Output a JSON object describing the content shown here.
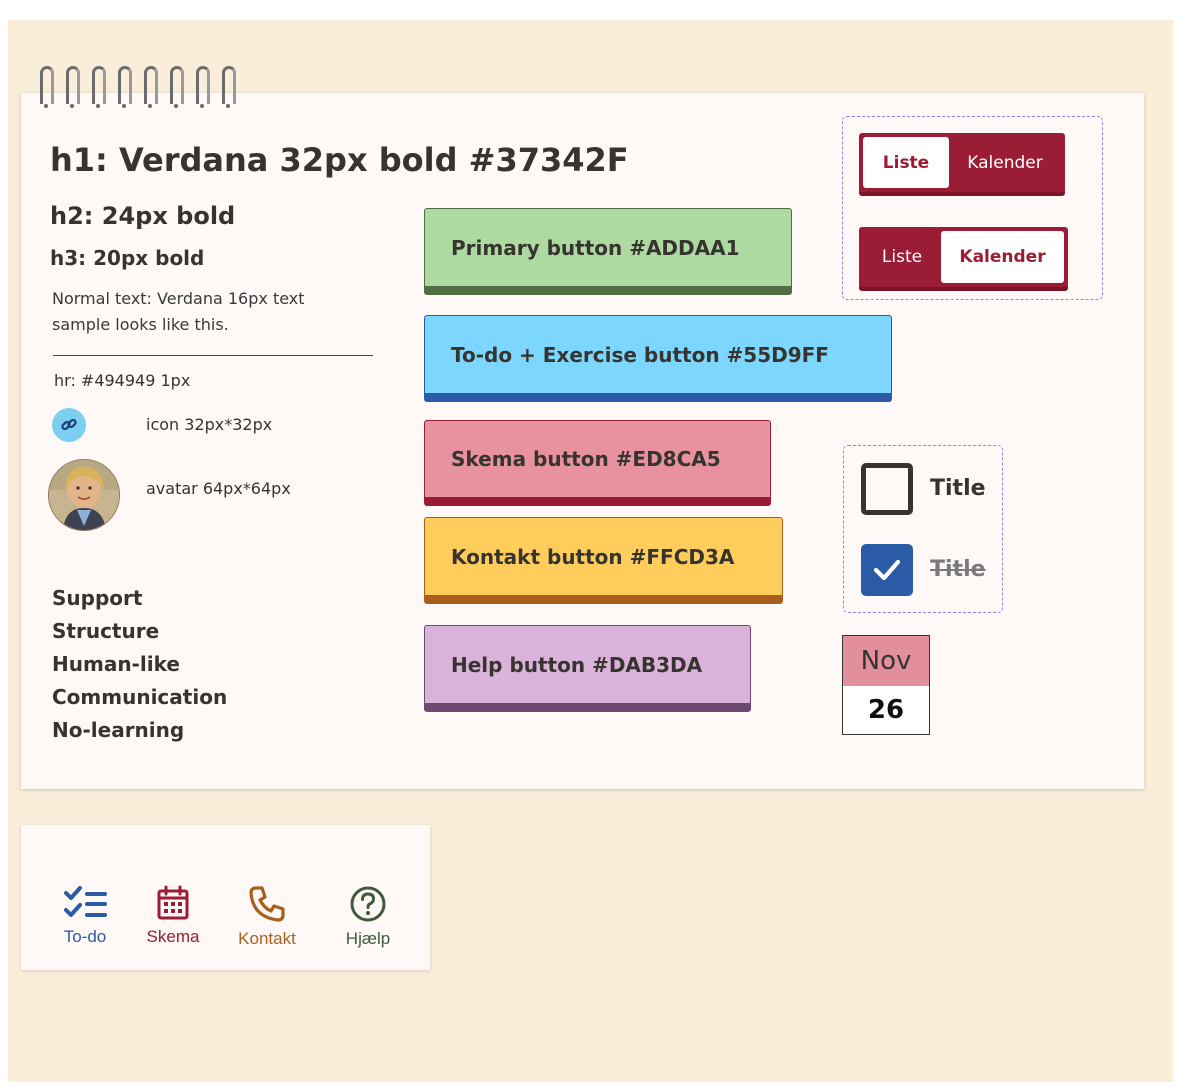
{
  "typography": {
    "h1": "h1: Verdana 32px bold #37342F",
    "h2": "h2: 24px bold",
    "h3": "h3: 20px bold",
    "normal": "Normal text: Verdana 16px text sample looks like this.",
    "hr_label": "hr: #494949 1px",
    "icon_label": "icon 32px*32px",
    "avatar_label": "avatar 64px*64px"
  },
  "values": [
    "Support",
    "Structure",
    "Human-like",
    "Communication",
    "No-learning"
  ],
  "buttons": {
    "primary": "Primary button #ADDAA1",
    "todo": "To-do + Exercise button #55D9FF",
    "skema": "Skema button #ED8CA5",
    "kontakt": "Kontakt button #FFCD3A",
    "help": "Help button #DAB3DA"
  },
  "toggles": {
    "first": {
      "left": "Liste",
      "right": "Kalender",
      "active": "left"
    },
    "second": {
      "left": "Liste",
      "right": "Kalender",
      "active": "right"
    }
  },
  "checkboxes": [
    {
      "label": "Title",
      "checked": false
    },
    {
      "label": "Title",
      "checked": true
    }
  ],
  "calendar": {
    "month": "Nov",
    "day": "26"
  },
  "navbar": [
    {
      "label": "To-do",
      "icon": "checklist-icon",
      "color": "#2B5BA6"
    },
    {
      "label": "Skema",
      "icon": "calendar-icon",
      "color": "#9B1C35"
    },
    {
      "label": "Kontakt",
      "icon": "phone-icon",
      "color": "#A9601C"
    },
    {
      "label": "Hjælp",
      "icon": "help-icon",
      "color": "#3F5A3A"
    }
  ],
  "colors": {
    "text": "#37342F",
    "hr": "#494949",
    "primary": "#ADDAA1",
    "todo": "#55D9FF",
    "skema": "#ED8CA5",
    "kontakt": "#FFCD3A",
    "help": "#DAB3DA",
    "toggle": "#9B1C35",
    "background": "#FAEEDB"
  }
}
